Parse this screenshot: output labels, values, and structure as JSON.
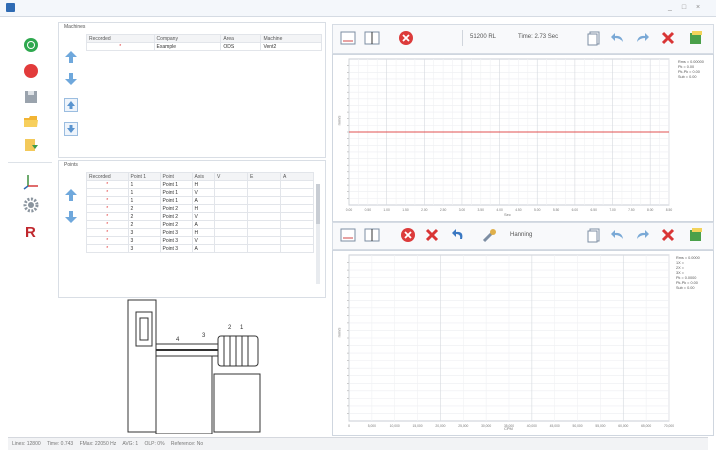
{
  "window": {
    "min": "_",
    "max": "□",
    "close": "×"
  },
  "icons": {
    "record": "record-icon",
    "stop": "stop-icon",
    "save": "save-icon",
    "open": "open-folder-icon",
    "export": "export-icon",
    "axes": "axes-icon",
    "settings": "gear-icon",
    "r": "r-icon"
  },
  "left_toolbar": {
    "r_label": "R"
  },
  "machines": {
    "title": "Machines",
    "columns": [
      "Recorded",
      "Company",
      "Area",
      "Machine"
    ],
    "rows": [
      {
        "recorded": "*",
        "company": "Example",
        "area": "ODS",
        "machine": "Vent2"
      }
    ]
  },
  "points": {
    "title": "Points",
    "columns": [
      "Recorded",
      "Point 1",
      "Point",
      "Axis",
      "V",
      "E",
      "A"
    ],
    "rows": [
      {
        "rec": "*",
        "num": "1",
        "name": "Point 1",
        "axis": "H"
      },
      {
        "rec": "*",
        "num": "1",
        "name": "Point 1",
        "axis": "V"
      },
      {
        "rec": "*",
        "num": "1",
        "name": "Point 1",
        "axis": "A"
      },
      {
        "rec": "*",
        "num": "2",
        "name": "Point 2",
        "axis": "H"
      },
      {
        "rec": "*",
        "num": "2",
        "name": "Point 2",
        "axis": "V"
      },
      {
        "rec": "*",
        "num": "2",
        "name": "Point 2",
        "axis": "A"
      },
      {
        "rec": "*",
        "num": "3",
        "name": "Point 3",
        "axis": "H"
      },
      {
        "rec": "*",
        "num": "3",
        "name": "Point 3",
        "axis": "V"
      },
      {
        "rec": "*",
        "num": "3",
        "name": "Point 3",
        "axis": "A"
      }
    ]
  },
  "diagram": {
    "labels": [
      "4",
      "3",
      "2",
      "1"
    ]
  },
  "top_chart": {
    "toolbar": {
      "lines_label": "51200 RL",
      "time_label": "Time: 2.73 Sec"
    },
    "ylabel": "mm/s",
    "xlabel": "Sec",
    "ticks_x": [
      "0.00",
      "0.25",
      "0.50",
      "0.75",
      "1.00",
      "1.25",
      "1.50",
      "1.75",
      "2.00",
      "2.25",
      "2.50",
      "2.75",
      "3.00",
      "3.25",
      "3.50",
      "3.75",
      "4.00",
      "4.25",
      "4.50",
      "4.75",
      "5.00",
      "5.25",
      "5.50",
      "5.75",
      "6.00",
      "6.25",
      "6.50",
      "6.75",
      "7.00",
      "7.25",
      "7.50",
      "7.75",
      "8.00",
      "8.25",
      "8.50"
    ],
    "legend": [
      "Rms = 0.00000",
      "Pk = 0.00",
      "Pk-Pk = 0.00",
      "Sub = 0.00"
    ]
  },
  "bottom_chart": {
    "toolbar": {
      "window_label": "Hanning"
    },
    "ylabel": "mm/s",
    "xlabel": "CPM",
    "ticks_x": [
      "0",
      "5,000",
      "10,000",
      "15,000",
      "20,000",
      "25,000",
      "30,000",
      "35,000",
      "40,000",
      "45,000",
      "50,000",
      "55,000",
      "60,000",
      "65,000",
      "70,000"
    ],
    "legend": [
      "Rms = 0.0000",
      "1X =",
      "2X =",
      "3X =",
      "Pk = 0.0000",
      "Pk-Pk = 0.00",
      "Sub = 0.00"
    ]
  },
  "chart_data": [
    {
      "type": "line",
      "title": "",
      "xlabel": "Sec",
      "ylabel": "mm/s",
      "x": [
        0,
        8.5
      ],
      "series": [
        {
          "values": [
            0,
            0
          ]
        }
      ],
      "grid": true
    },
    {
      "type": "line",
      "title": "",
      "xlabel": "CPM",
      "ylabel": "mm/s",
      "x": [
        0,
        70000
      ],
      "series": [],
      "grid": true
    }
  ],
  "statusbar": {
    "lines": "Lines: 12800",
    "time": "Time: 0.743",
    "fmax": "FMax: 22050 Hz",
    "avg": "AVG: 1",
    "olp": "OLP: 0%",
    "reference": "Reference: No"
  },
  "colors": {
    "accent": "#2f6bb3",
    "record_green": "#2fa84f",
    "stop_red": "#e23b3b",
    "trace": "#e05050"
  }
}
